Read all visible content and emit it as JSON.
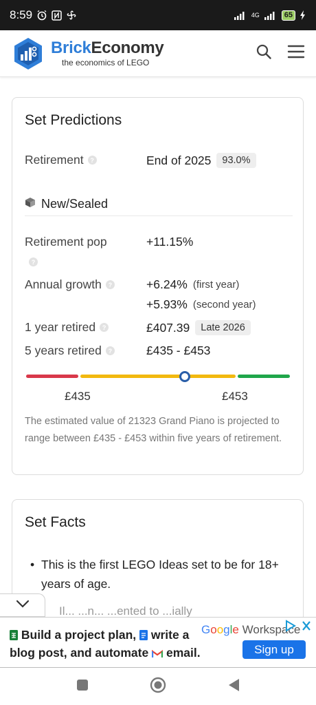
{
  "status_bar": {
    "time": "8:59",
    "network": "4G",
    "battery": "65"
  },
  "header": {
    "brand_part1": "Brick",
    "brand_part2": "Economy",
    "tagline": "the economics of LEGO",
    "icons": [
      "search-icon",
      "menu-icon"
    ]
  },
  "predictions": {
    "title": "Set Predictions",
    "retirement_label": "Retirement",
    "retirement_value": "End of 2025",
    "retirement_confidence": "93.0%",
    "condition_label": "New/Sealed",
    "retirement_pop_label": "Retirement pop",
    "retirement_pop_value": "+11.15%",
    "annual_growth_label": "Annual growth",
    "growth_first": "+6.24%",
    "growth_first_note": "(first year)",
    "growth_second": "+5.93%",
    "growth_second_note": "(second year)",
    "one_year_label": "1 year retired",
    "one_year_value": "£407.39",
    "one_year_date": "Late 2026",
    "five_year_label": "5 years retired",
    "five_year_value": "£435 - £453",
    "range_low": "£435",
    "range_high": "£453",
    "range_marker_fraction": 0.5,
    "colors": {
      "red": "#d9384a",
      "yellow": "#f2b90f",
      "green": "#1fa64a",
      "marker": "#2a5ea8"
    },
    "description": "The estimated value of 21323 Grand Piano is projected to range between £435 - £453 within five years of retirement."
  },
  "facts": {
    "title": "Set Facts",
    "items": [
      "This is the first LEGO Ideas set to be for 18+ years of age."
    ],
    "partial_item": "Il... ...n... ...ented to ...ially"
  },
  "ad": {
    "line1_a": "Build a project plan,",
    "line1_b": "write a",
    "line2_a": "blog post, and automate",
    "line2_b": "email.",
    "brand_google": [
      "G",
      "o",
      "o",
      "g",
      "l",
      "e"
    ],
    "brand_product": "Workspace",
    "cta": "Sign up"
  }
}
